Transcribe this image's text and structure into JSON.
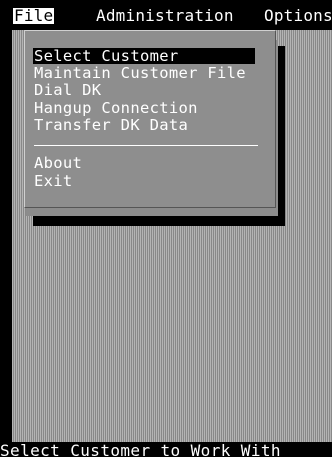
{
  "menubar": {
    "file": "File",
    "administration": "Administration",
    "options": "Options"
  },
  "file_menu": {
    "items": [
      "Select Customer",
      "Maintain Customer File",
      "Dial DK",
      "Hangup Connection",
      "Transfer DK Data"
    ],
    "items_after_separator": [
      "About",
      "Exit"
    ],
    "selected": "Select Customer"
  },
  "statusbar": {
    "text": "Select Customer to Work With"
  },
  "colors": {
    "background": "#000000",
    "menu_face": "#8e8e8e",
    "desktop_dither": "#a0a0a0",
    "highlight": "#000000",
    "text": "#ffffff"
  }
}
